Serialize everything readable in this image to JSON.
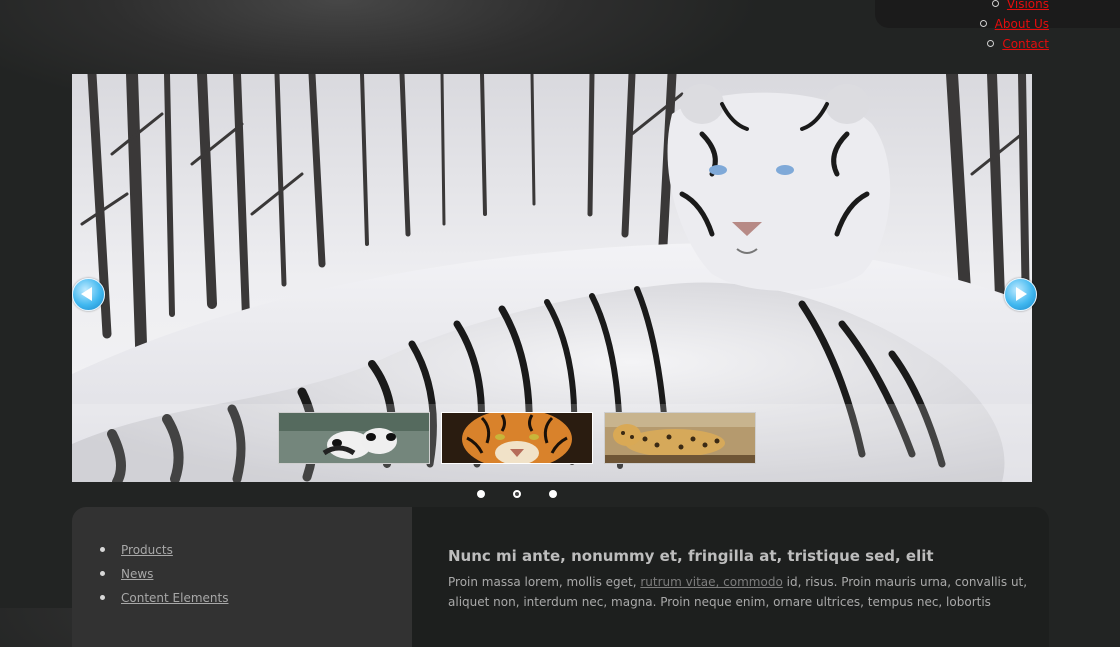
{
  "nav": {
    "items": [
      {
        "label": "Visions"
      },
      {
        "label": "About Us"
      },
      {
        "label": "Contact"
      }
    ]
  },
  "slider": {
    "thumbnails": [
      {
        "name": "panda-thumbnail"
      },
      {
        "name": "tiger-thumbnail"
      },
      {
        "name": "leopard-thumbnail"
      }
    ],
    "active_dot": 1,
    "dot_count": 3
  },
  "sidebar": {
    "items": [
      {
        "label": "Products"
      },
      {
        "label": "News"
      },
      {
        "label": "Content Elements"
      }
    ]
  },
  "article": {
    "heading": "Nunc mi ante, nonummy et, fringilla at, tristique sed, elit",
    "text_before_link": "Proin massa lorem, mollis eget, ",
    "link": "rutrum vitae, commodo",
    "text_after_link": " id, risus. Proin mauris urna, convallis ut, aliquet non, interdum nec, magna. Proin neque enim, ornare ultrices, tempus nec, lobortis"
  },
  "colors": {
    "nav_link": "#e30d0d",
    "background": "#222423",
    "sidebar_bg": "#323232",
    "content_bg": "#1d1f1e",
    "arrow_blue": "#41b8f0"
  },
  "icons": {
    "prev": "arrow-left-icon",
    "next": "arrow-right-icon"
  }
}
